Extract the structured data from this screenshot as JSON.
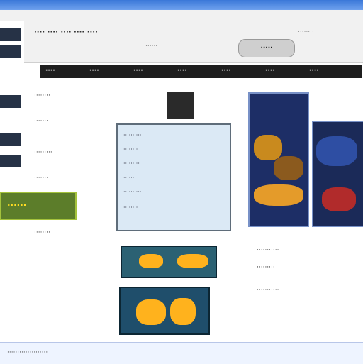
{
  "header": {
    "title": "···· ···· ···· ···· ····",
    "subtitle": "······",
    "right": "········",
    "badge": "·····"
  },
  "nav": {
    "items": [
      "····",
      "····",
      "····",
      "····",
      "····",
      "····",
      "····"
    ]
  },
  "left": {
    "lines": [
      "········",
      "·······",
      "·········",
      "·······",
      "········"
    ],
    "promo": "······"
  },
  "panel": {
    "lines": [
      "··········",
      "········",
      "·········",
      "·······",
      "··········",
      "········"
    ]
  },
  "right": {
    "lines": [
      "···········",
      "·········",
      "···········"
    ]
  },
  "footer": {
    "text": "····················"
  }
}
